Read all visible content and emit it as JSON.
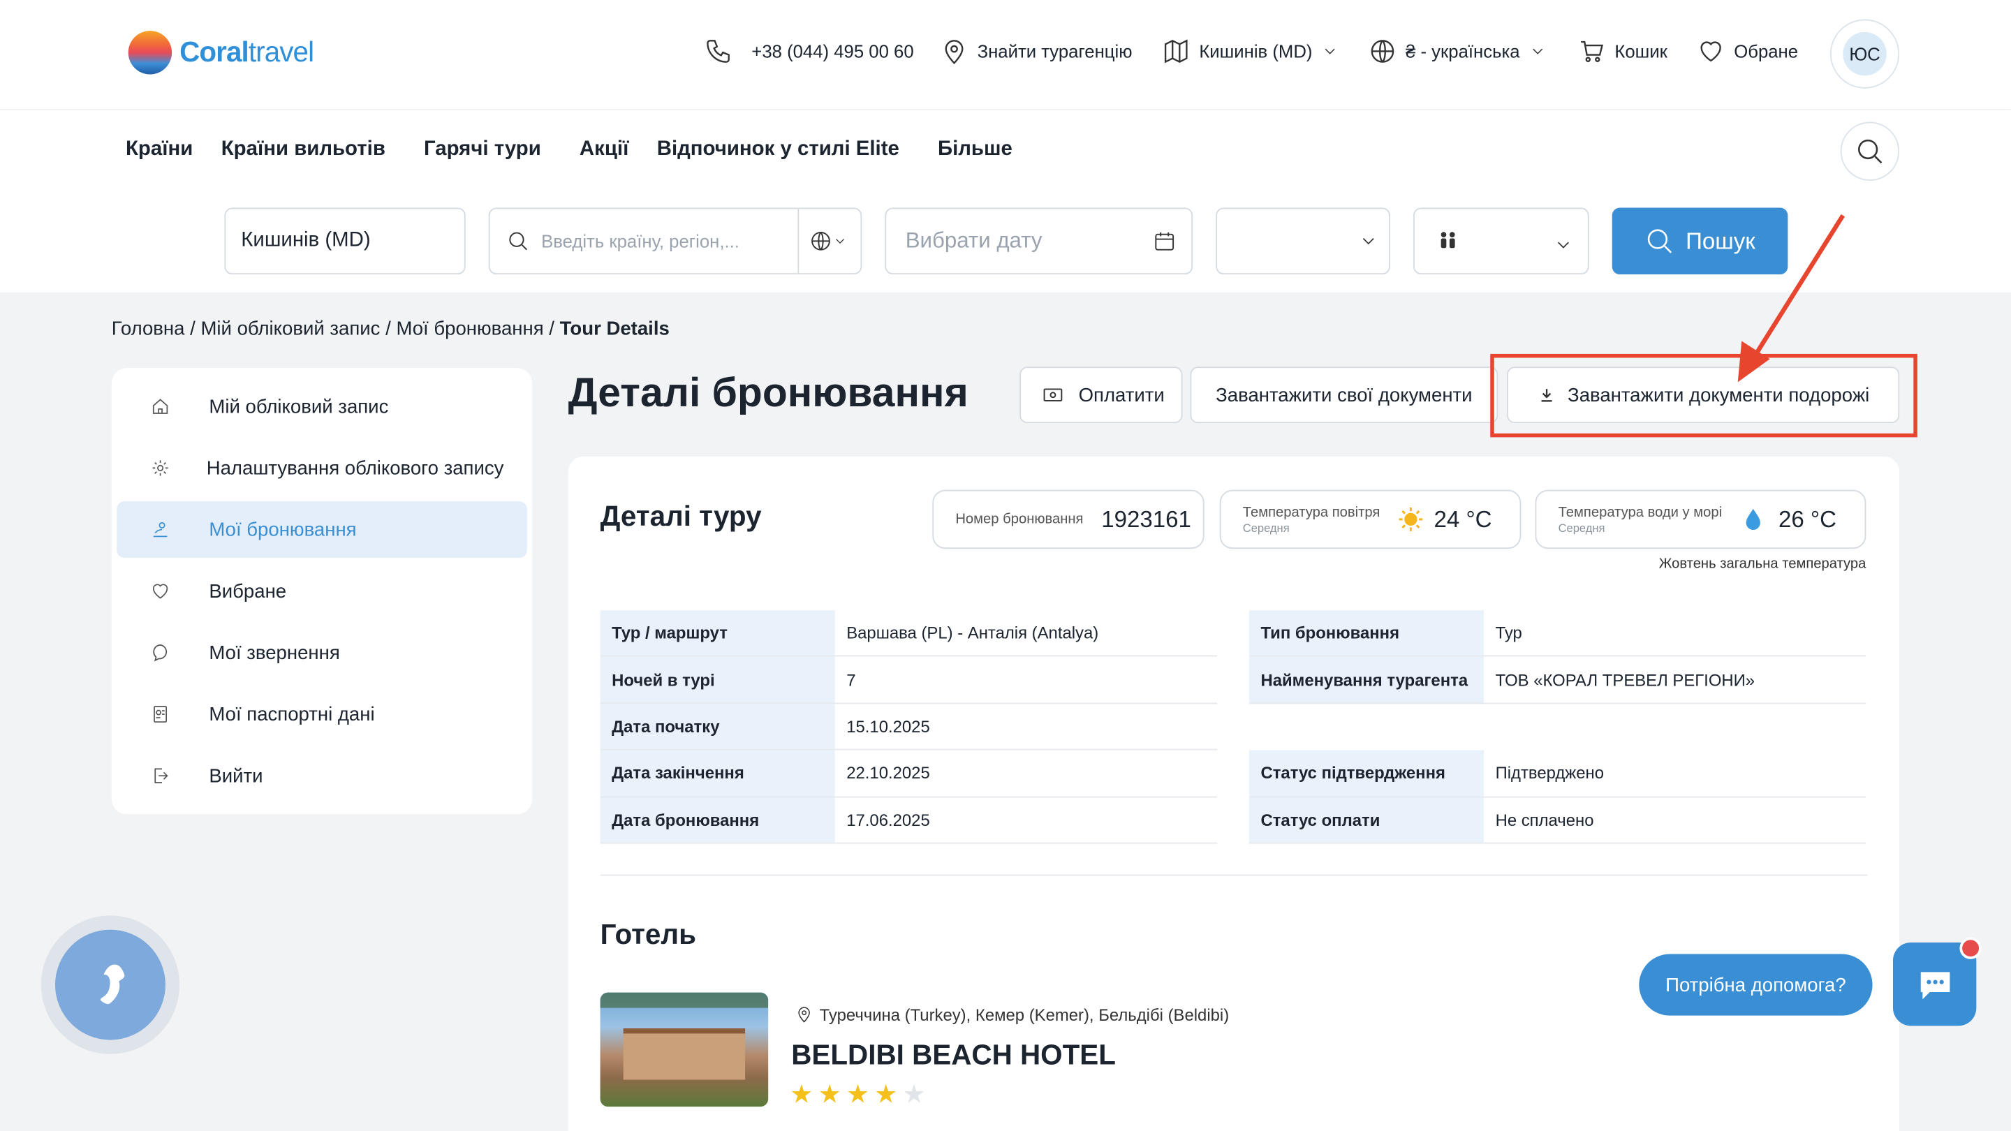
{
  "header": {
    "logo": {
      "part1": "Coral",
      "part2": "travel"
    },
    "phone": "+38 (044) 495 00 60",
    "find_agency": "Знайти турагенцію",
    "city": "Кишинів (MD)",
    "language": "₴ - українська",
    "cart": "Кошик",
    "favorites": "Обране",
    "avatar_initials": "ЮС"
  },
  "menu": {
    "items": [
      "Країни",
      "Країни вильотів",
      "Гарячі тури",
      "Акції",
      "Відпочинок у стилі Elite",
      "Більше"
    ]
  },
  "search": {
    "departure": "Кишинів (MD)",
    "destination_placeholder": "Введіть країну, регіон,...",
    "date_placeholder": "Вибрати дату",
    "button": "Пошук"
  },
  "breadcrumb": {
    "items": [
      "Головна",
      "Мій обліковий запис",
      "Мої бронювання"
    ],
    "current": "Tour Details",
    "sep": "/"
  },
  "sidebar": {
    "items": [
      {
        "label": "Мій обліковий запис",
        "icon": "home-icon"
      },
      {
        "label": "Налаштування облікового запису",
        "icon": "gear-icon"
      },
      {
        "label": "Мої бронювання",
        "icon": "booking-icon"
      },
      {
        "label": "Вибране",
        "icon": "heart-icon"
      },
      {
        "label": "Мої звернення",
        "icon": "message-icon"
      },
      {
        "label": "Мої паспортні дані",
        "icon": "passport-icon"
      },
      {
        "label": "Вийти",
        "icon": "logout-icon"
      }
    ],
    "active_index": 2
  },
  "page": {
    "title": "Деталі бронювання",
    "pay_button": "Оплатити",
    "upload_docs_button": "Завантажити свої документи",
    "download_docs_button": "Завантажити документи подорожі"
  },
  "tour": {
    "title": "Деталі туру",
    "booking_number_label": "Номер бронювання",
    "booking_number": "1923161",
    "air_temp_label": "Температура повітря",
    "air_temp_sub": "Середня",
    "air_temp": "24 °C",
    "water_temp_label": "Температура води у морі",
    "water_temp_sub": "Середня",
    "water_temp": "26 °C",
    "temp_note": "Жовтень загальна температура",
    "left_rows": [
      {
        "k": "Тур / маршрут",
        "v": "Варшава (PL) - Анталія (Antalya)"
      },
      {
        "k": "Ночей в турі",
        "v": "7"
      },
      {
        "k": "Дата початку",
        "v": "15.10.2025"
      },
      {
        "k": "Дата закінчення",
        "v": "22.10.2025"
      },
      {
        "k": "Дата бронювання",
        "v": "17.06.2025"
      }
    ],
    "right_rows": [
      {
        "k": "Тип бронювання",
        "v": "Тур"
      },
      {
        "k": "Найменування турагента",
        "v": "ТОВ «КОРАЛ ТРЕВЕЛ РЕГІОНИ»"
      },
      {
        "k": "",
        "v": ""
      },
      {
        "k": "Статус підтвердження",
        "v": "Підтверджено"
      },
      {
        "k": "Статус оплати",
        "v": "Не сплачено"
      }
    ]
  },
  "hotel": {
    "heading": "Готель",
    "location": "Туреччина (Turkey), Кемер (Kemer), Бельдібі (Beldibi)",
    "name": "BELDIBI BEACH HOTEL",
    "stars": 4,
    "max_stars": 5
  },
  "help": {
    "label": "Потрібна допомога?"
  },
  "colors": {
    "accent": "#3a8fd4",
    "highlight": "#e8452f",
    "active_bg": "#e3eefa"
  }
}
